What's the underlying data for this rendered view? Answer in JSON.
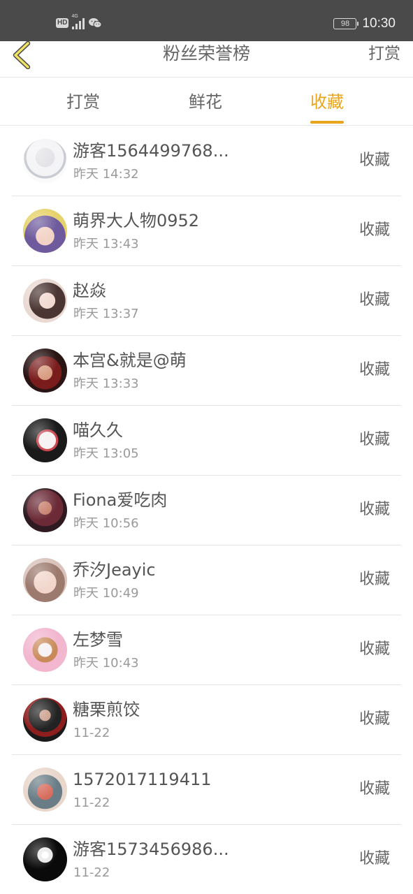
{
  "status_bar": {
    "hd": "HD",
    "network": "4G",
    "battery": "98",
    "time": "10:30"
  },
  "nav": {
    "title": "粉丝荣誉榜",
    "action": "打赏",
    "back_icon": "chevron-left-icon"
  },
  "colors": {
    "accent": "#e9a51c",
    "status_bar": "#4a4a4a",
    "text": "#555555",
    "subtext": "#9a9a9a"
  },
  "tabs": [
    {
      "label": "打赏",
      "active": false
    },
    {
      "label": "鲜花",
      "active": false
    },
    {
      "label": "收藏",
      "active": true
    }
  ],
  "fans": [
    {
      "name": "游客1564499768...",
      "time": "昨天 14:32",
      "action": "收藏"
    },
    {
      "name": "萌界大人物0952",
      "time": "昨天 13:43",
      "action": "收藏"
    },
    {
      "name": "赵焱",
      "time": "昨天 13:37",
      "action": "收藏"
    },
    {
      "name": "本宫&就是@萌",
      "time": "昨天 13:33",
      "action": "收藏"
    },
    {
      "name": "喵久久",
      "time": "昨天 13:05",
      "action": "收藏"
    },
    {
      "name": "Fiona爱吃肉",
      "time": "昨天 10:56",
      "action": "收藏"
    },
    {
      "name": "乔汐Jeayic",
      "time": "昨天 10:49",
      "action": "收藏"
    },
    {
      "name": "左梦雪",
      "time": "昨天 10:43",
      "action": "收藏"
    },
    {
      "name": "糖栗煎饺",
      "time": "11-22",
      "action": "收藏"
    },
    {
      "name": "1572017119411",
      "time": "11-22",
      "action": "收藏"
    },
    {
      "name": "游客1573456986...",
      "time": "11-22",
      "action": "收藏"
    }
  ]
}
